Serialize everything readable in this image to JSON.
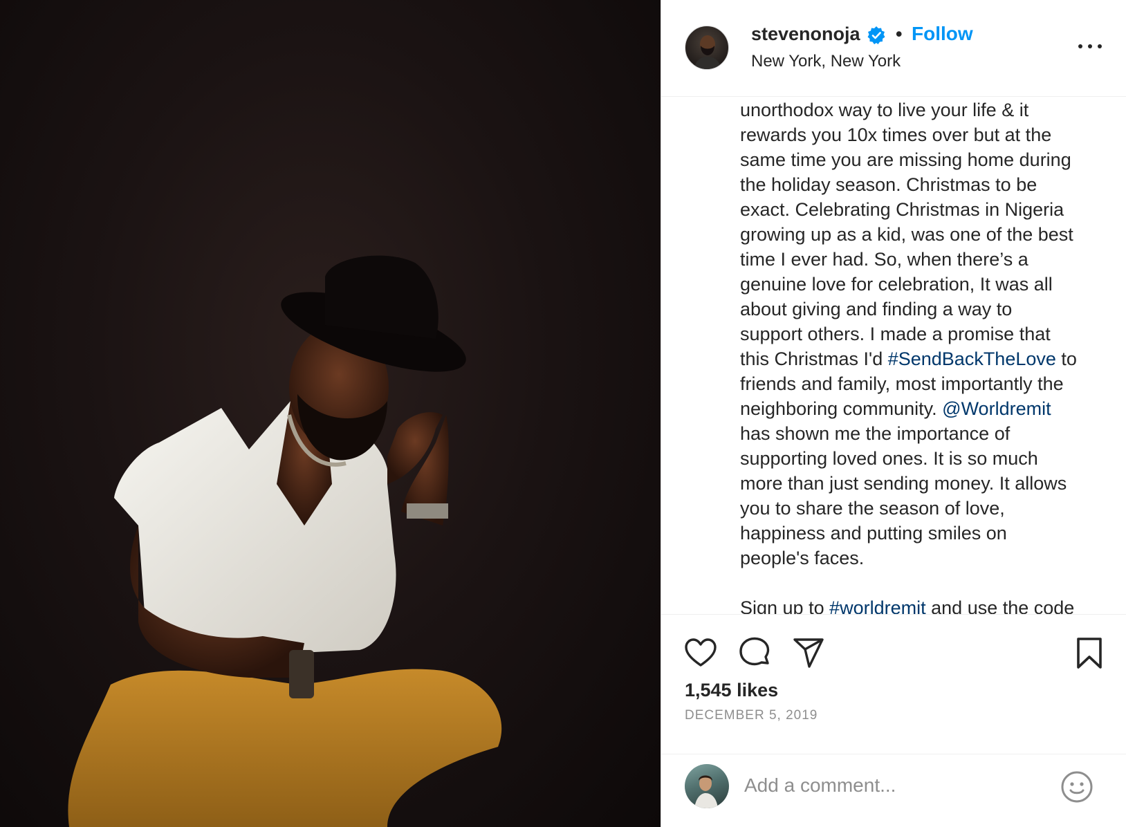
{
  "post": {
    "username": "stevenonoja",
    "verified": true,
    "separator": "•",
    "follow_label": "Follow",
    "location": "New York, New York",
    "caption_lines": [
      [
        {
          "t": "unorthodox way to live your life & it"
        }
      ],
      [
        {
          "t": "rewards you 10x times over but at the"
        }
      ],
      [
        {
          "t": "same time you are missing home during"
        }
      ],
      [
        {
          "t": "the holiday season. Christmas to be"
        }
      ],
      [
        {
          "t": "exact. Celebrating Christmas in Nigeria"
        }
      ],
      [
        {
          "t": "growing up as a kid, was one of the best"
        }
      ],
      [
        {
          "t": "time I ever had. So, when there’s a"
        }
      ],
      [
        {
          "t": "genuine love for celebration, It was all"
        }
      ],
      [
        {
          "t": "about giving and finding a way to"
        }
      ],
      [
        {
          "t": "support others. I made a promise that"
        }
      ],
      [
        {
          "t": "this Christmas I'd "
        },
        {
          "t": "#SendBackTheLove",
          "tag": true
        },
        {
          "t": " to"
        }
      ],
      [
        {
          "t": "friends and family, most importantly the"
        }
      ],
      [
        {
          "t": "neighboring community. "
        },
        {
          "t": "@Worldremit",
          "tag": true
        }
      ],
      [
        {
          "t": "has shown me the importance of"
        }
      ],
      [
        {
          "t": "supporting loved ones. It is so much"
        }
      ],
      [
        {
          "t": "more than just sending money. It allows"
        }
      ],
      [
        {
          "t": "you to share the season of love,"
        }
      ],
      [
        {
          "t": "happiness and putting smiles on"
        }
      ],
      [
        {
          "t": "people's faces."
        }
      ],
      [
        {
          "t": ""
        }
      ],
      [
        {
          "t": "Sign up to "
        },
        {
          "t": "#worldremit",
          "tag": true
        },
        {
          "t": " and use the code"
        }
      ]
    ],
    "likes": "1,545 likes",
    "date": "DECEMBER 5, 2019"
  },
  "actions": {
    "like_icon": "heart-icon",
    "comment_icon": "comment-bubble-icon",
    "share_icon": "paper-plane-icon",
    "save_icon": "bookmark-icon"
  },
  "comment": {
    "placeholder": "Add a comment...",
    "emoji_icon": "smiley-icon"
  },
  "colors": {
    "follow": "#0095f6",
    "tag": "#00376b",
    "verified": "#0095f6",
    "muted": "#8e8e8e"
  }
}
